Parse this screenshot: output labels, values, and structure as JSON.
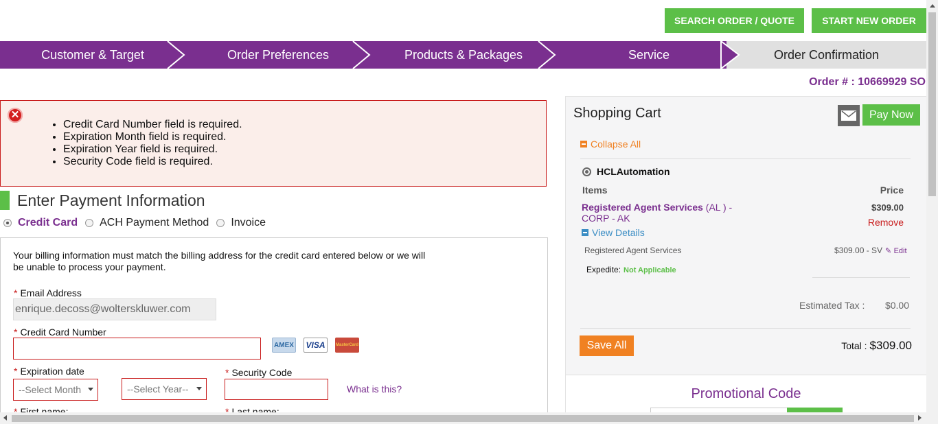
{
  "header": {
    "search_btn": "SEARCH ORDER / QUOTE",
    "new_order_btn": "START NEW ORDER"
  },
  "steps": [
    {
      "label": "Customer & Target"
    },
    {
      "label": "Order Preferences"
    },
    {
      "label": "Products & Packages"
    },
    {
      "label": "Service"
    },
    {
      "label": "Order Confirmation"
    }
  ],
  "order_no": "Order # : 10669929 SO",
  "errors": [
    "Credit Card Number field is required.",
    "Expiration Month field is required.",
    "Expiration Year field is required.",
    "Security Code field is required."
  ],
  "payment": {
    "title": "Enter Payment Information",
    "methods": [
      "Credit Card",
      "ACH Payment Method",
      "Invoice"
    ],
    "billing_note": "Your billing information must match the billing address for the credit card entered below or we will be unable to process your payment.",
    "email_label": "Email Address",
    "email_value": "enrique.decoss@wolterskluwer.com",
    "cc_label": "Credit Card Number",
    "exp_label": "Expiration date",
    "month_value": "--Select Month",
    "year_value": "--Select Year--",
    "sec_label": "Security Code",
    "what_link": "What is this?",
    "first_name_label": "First name:",
    "last_name_label": "Last name:",
    "cards": [
      "AMEX",
      "VISA",
      "MasterCard"
    ]
  },
  "cart": {
    "title": "Shopping Cart",
    "pay_now": "Pay Now",
    "collapse_all": "Collapse All",
    "account": "HCLAutomation",
    "items_header": "Items",
    "price_header": "Price",
    "item_name": "Registered Agent Services",
    "item_suffix": "(AL ) - CORP - AK",
    "item_price": "$309.00",
    "remove": "Remove",
    "view_details": "View Details",
    "sub_name": "Registered Agent Services",
    "sub_price": "$309.00 - SV",
    "edit": "Edit",
    "expedite_label": "Expedite:",
    "expedite_value": "Not Applicable",
    "tax_label": "Estimated Tax :",
    "tax_value": "$0.00",
    "save_all": "Save All",
    "total_label": "Total :",
    "total_value": "$309.00",
    "promo_title": "Promotional Code"
  },
  "colors": {
    "brand_purple": "#7a2f8f",
    "green": "#5cbf48",
    "orange": "#f08122",
    "error_red": "#c81a1a"
  }
}
